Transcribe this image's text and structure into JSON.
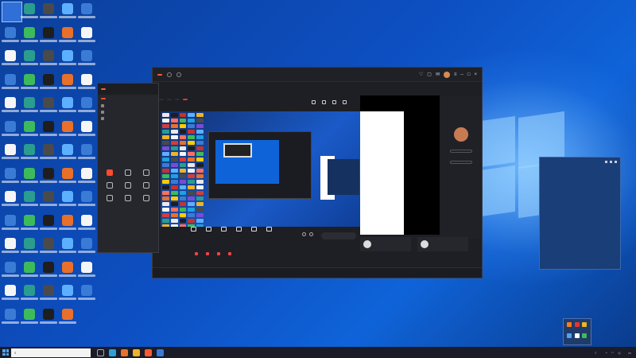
{
  "desktop": {
    "clock_widget": {
      "value": "",
      "caption": ""
    },
    "icon_colors": [
      "#e9e9e9",
      "#3a7bd5",
      "#d63b3b",
      "#3dbb5b",
      "#f0b323",
      "#1e1e1e",
      "#7a4bd6",
      "#e8702a",
      "#20a0e0",
      "#f5f5f5",
      "#c8322b",
      "#2a9d8f",
      "#ffcc00",
      "#4a4a4a",
      "#ff6f61",
      "#5db0ff"
    ]
  },
  "app_window": {
    "brand": "",
    "title": "",
    "tabs_right": [
      "",
      "",
      ""
    ],
    "scene_chips": [
      "",
      "",
      "",
      ""
    ],
    "live_chip": "",
    "streamer": {
      "name": "",
      "id": "",
      "follow_label": "",
      "gift_label": ""
    },
    "controls": [
      "",
      "",
      "",
      "",
      "",
      ""
    ],
    "start_live_label": "",
    "cards": [
      {
        "name": "",
        "text": ""
      },
      {
        "name": "",
        "text": ""
      }
    ],
    "feed": [
      "",
      "",
      "",
      ""
    ],
    "bottom_tabs": [
      "",
      "",
      "",
      "",
      "",
      ""
    ],
    "bottom_right": "",
    "comments": [
      "",
      ""
    ]
  },
  "side_window": {
    "brand": "",
    "tabs": [
      "",
      "",
      ""
    ],
    "scene_rows": [
      "",
      "",
      ""
    ],
    "tools_title": "",
    "tools": [
      "",
      "",
      "",
      "",
      "",
      "",
      "",
      "",
      ""
    ]
  },
  "chat_panel": {
    "title": "",
    "messages": [
      {
        "tag": "",
        "text": ""
      },
      {
        "tag": "",
        "text": ""
      }
    ],
    "info": [
      "",
      "",
      "",
      "",
      "",
      ""
    ]
  },
  "taskbar": {
    "search_placeholder": "",
    "weather": "",
    "time": "",
    "date": ""
  },
  "colors": {
    "accent": "#ff5b2d",
    "live": "#e5362a",
    "wallpaper": "#0d4fc2"
  }
}
